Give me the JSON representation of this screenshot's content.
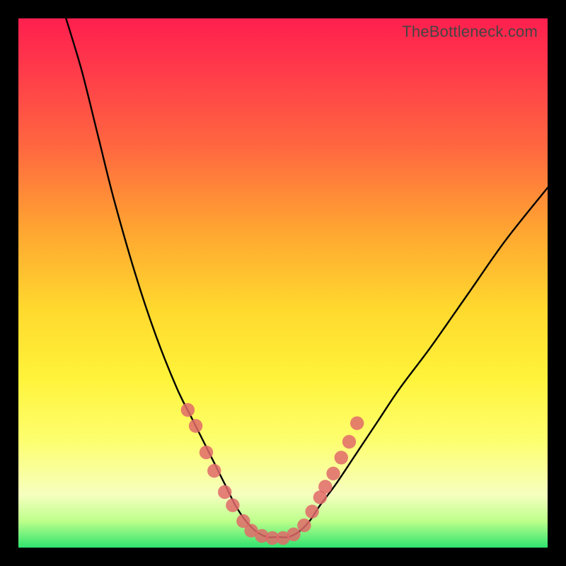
{
  "watermark": "TheBottleneck.com",
  "chart_data": {
    "type": "line",
    "title": "",
    "xlabel": "",
    "ylabel": "",
    "xlim": [
      0,
      100
    ],
    "ylim": [
      0,
      100
    ],
    "grid": false,
    "legend": false,
    "series": [
      {
        "name": "curve",
        "color": "#000000",
        "x": [
          9,
          12,
          15,
          18,
          22,
          26,
          30,
          33,
          35,
          37,
          39,
          41,
          43,
          45,
          47,
          49,
          51,
          53,
          55,
          57,
          60,
          64,
          68,
          72,
          78,
          85,
          92,
          100
        ],
        "y": [
          100,
          90,
          78,
          66,
          52,
          40,
          30,
          24,
          20,
          16,
          12,
          8,
          5,
          3,
          2,
          2,
          2,
          3,
          5,
          8,
          12,
          18,
          24,
          30,
          38,
          48,
          58,
          68
        ]
      }
    ],
    "markers": [
      {
        "x": 32,
        "y": 26,
        "r": 1.3
      },
      {
        "x": 33.5,
        "y": 23,
        "r": 1.3
      },
      {
        "x": 35.5,
        "y": 18,
        "r": 1.3
      },
      {
        "x": 37,
        "y": 14.5,
        "r": 1.3
      },
      {
        "x": 39,
        "y": 10.5,
        "r": 1.3
      },
      {
        "x": 40.5,
        "y": 8,
        "r": 1.3
      },
      {
        "x": 42.5,
        "y": 5,
        "r": 1.3
      },
      {
        "x": 44,
        "y": 3.2,
        "r": 1.3
      },
      {
        "x": 46,
        "y": 2.2,
        "r": 1.3
      },
      {
        "x": 48,
        "y": 1.8,
        "r": 1.3
      },
      {
        "x": 50,
        "y": 1.8,
        "r": 1.3
      },
      {
        "x": 52,
        "y": 2.5,
        "r": 1.3
      },
      {
        "x": 54,
        "y": 4.2,
        "r": 1.3
      },
      {
        "x": 55.5,
        "y": 6.8,
        "r": 1.3
      },
      {
        "x": 57,
        "y": 9.5,
        "r": 1.3
      },
      {
        "x": 58,
        "y": 11.5,
        "r": 1.3
      },
      {
        "x": 59.5,
        "y": 14,
        "r": 1.3
      },
      {
        "x": 61,
        "y": 17,
        "r": 1.3
      },
      {
        "x": 62.5,
        "y": 20,
        "r": 1.3
      },
      {
        "x": 64,
        "y": 23.5,
        "r": 1.3
      }
    ],
    "marker_color": "#e06a6a"
  }
}
